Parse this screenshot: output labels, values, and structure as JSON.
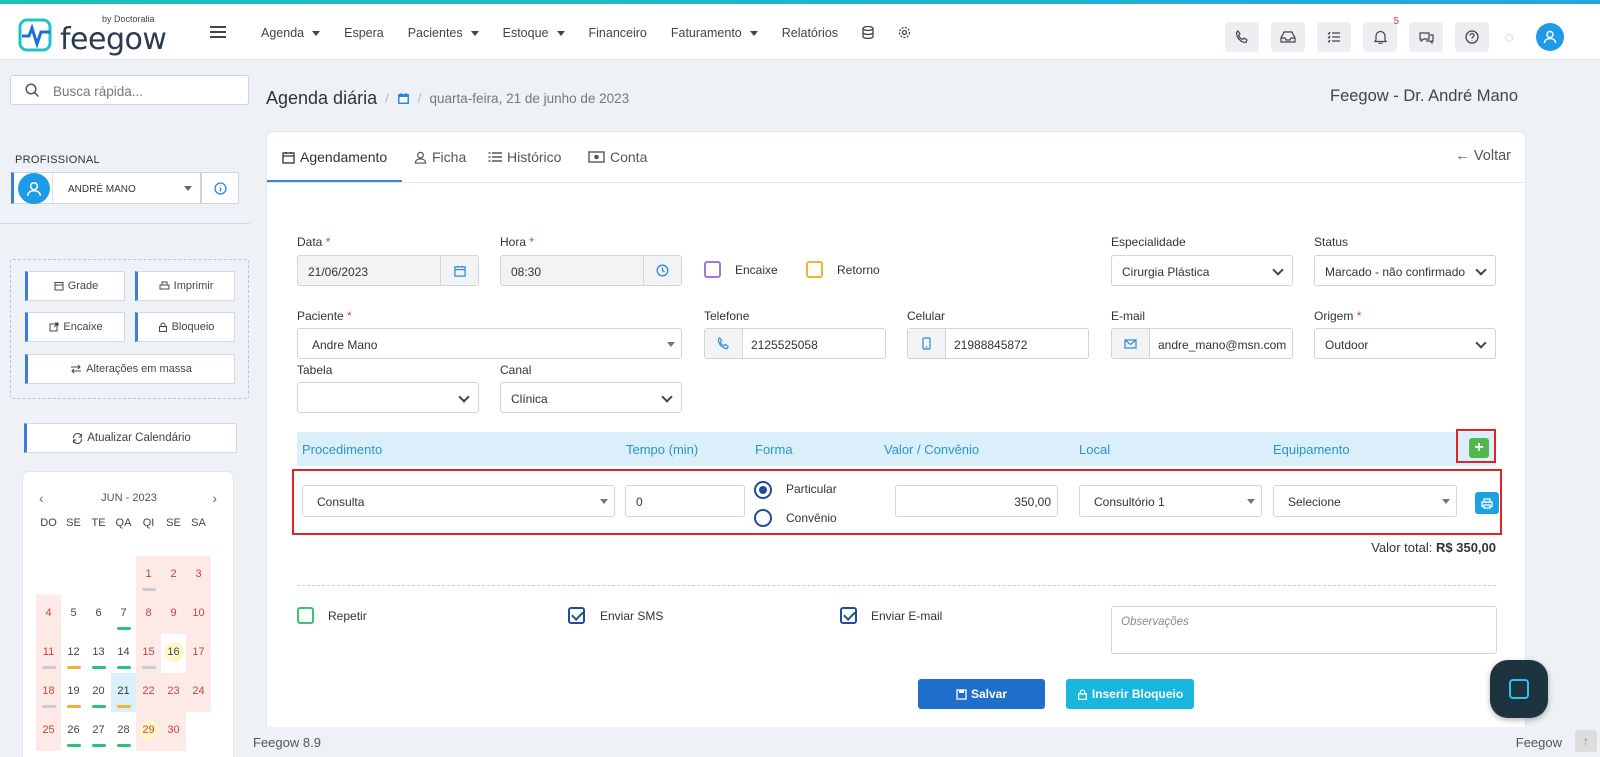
{
  "brand": {
    "logo": "feegow",
    "logo_sub": "by Doctoralia"
  },
  "nav": {
    "items": [
      {
        "label": "Agenda",
        "caret": true
      },
      {
        "label": "Espera",
        "caret": false
      },
      {
        "label": "Pacientes",
        "caret": true
      },
      {
        "label": "Estoque",
        "caret": true
      },
      {
        "label": "Financeiro",
        "caret": false
      },
      {
        "label": "Faturamento",
        "caret": true
      },
      {
        "label": "Relatórios",
        "caret": false
      }
    ],
    "notification_count": "5"
  },
  "sidebar": {
    "search_placeholder": "Busca rápida...",
    "profissional_label": "PROFISSIONAL",
    "profissional_name": "ANDRÉ MANO",
    "tools": {
      "grade": "Grade",
      "imprimir": "Imprimir",
      "encaixe": "Encaixe",
      "bloqueio": "Bloqueio",
      "alteracoes": "Alterações em massa"
    },
    "refresh": "Atualizar Calendário",
    "calendar": {
      "month": "JUN - 2023",
      "dow": [
        "DO",
        "SE",
        "TE",
        "QA",
        "QI",
        "SE",
        "SA"
      ],
      "weeks": [
        [
          "",
          "",
          "",
          "",
          "1",
          "2",
          "3"
        ],
        [
          "4",
          "5",
          "6",
          "7",
          "8",
          "9",
          "10"
        ],
        [
          "11",
          "12",
          "13",
          "14",
          "15",
          "16",
          "17"
        ],
        [
          "18",
          "19",
          "20",
          "21",
          "22",
          "23",
          "24"
        ],
        [
          "25",
          "26",
          "27",
          "28",
          "29",
          "30",
          ""
        ]
      ]
    }
  },
  "header": {
    "title": "Agenda diária",
    "date": "quarta-feira, 21 de junho de 2023",
    "owner": "Feegow - Dr. André Mano"
  },
  "tabs": [
    "Agendamento",
    "Ficha",
    "Histórico",
    "Conta"
  ],
  "back": "Voltar",
  "form": {
    "data_label": "Data",
    "data_value": "21/06/2023",
    "hora_label": "Hora",
    "hora_value": "08:30",
    "encaixe": "Encaixe",
    "retorno": "Retorno",
    "especialidade_label": "Especialidade",
    "especialidade_value": "Cirurgia Plástica",
    "status_label": "Status",
    "status_value": "Marcado - não confirmado",
    "paciente_label": "Paciente",
    "paciente_value": "Andre Mano",
    "telefone_label": "Telefone",
    "telefone_value": "2125525058",
    "celular_label": "Celular",
    "celular_value": "21988845872",
    "email_label": "E-mail",
    "email_value": "andre_mano@msn.com",
    "origem_label": "Origem",
    "origem_value": "Outdoor",
    "tabela_label": "Tabela",
    "tabela_value": "",
    "canal_label": "Canal",
    "canal_value": "Clínica"
  },
  "procedures": {
    "headers": [
      "Procedimento",
      "Tempo (min)",
      "Forma",
      "Valor / Convênio",
      "Local",
      "Equipamento"
    ],
    "row": {
      "procedimento": "Consulta",
      "tempo": "0",
      "forma_particular": "Particular",
      "forma_convenio": "Convênio",
      "valor": "350,00",
      "local": "Consultório 1",
      "equipamento": "Selecione"
    },
    "total_label": "Valor total:",
    "total_value": "R$ 350,00"
  },
  "options": {
    "repetir": "Repetir",
    "enviar_sms": "Enviar SMS",
    "enviar_email": "Enviar E-mail",
    "observacoes_placeholder": "Observações"
  },
  "actions": {
    "salvar": "Salvar",
    "inserir_bloqueio": "Inserir Bloqueio"
  },
  "footer": {
    "version": "Feegow 8.9",
    "right": "Feegow"
  },
  "colors": {
    "primary": "#2e86de",
    "accent": "#1da1e0",
    "highlight_box": "#e02424",
    "add": "#52b84c"
  }
}
